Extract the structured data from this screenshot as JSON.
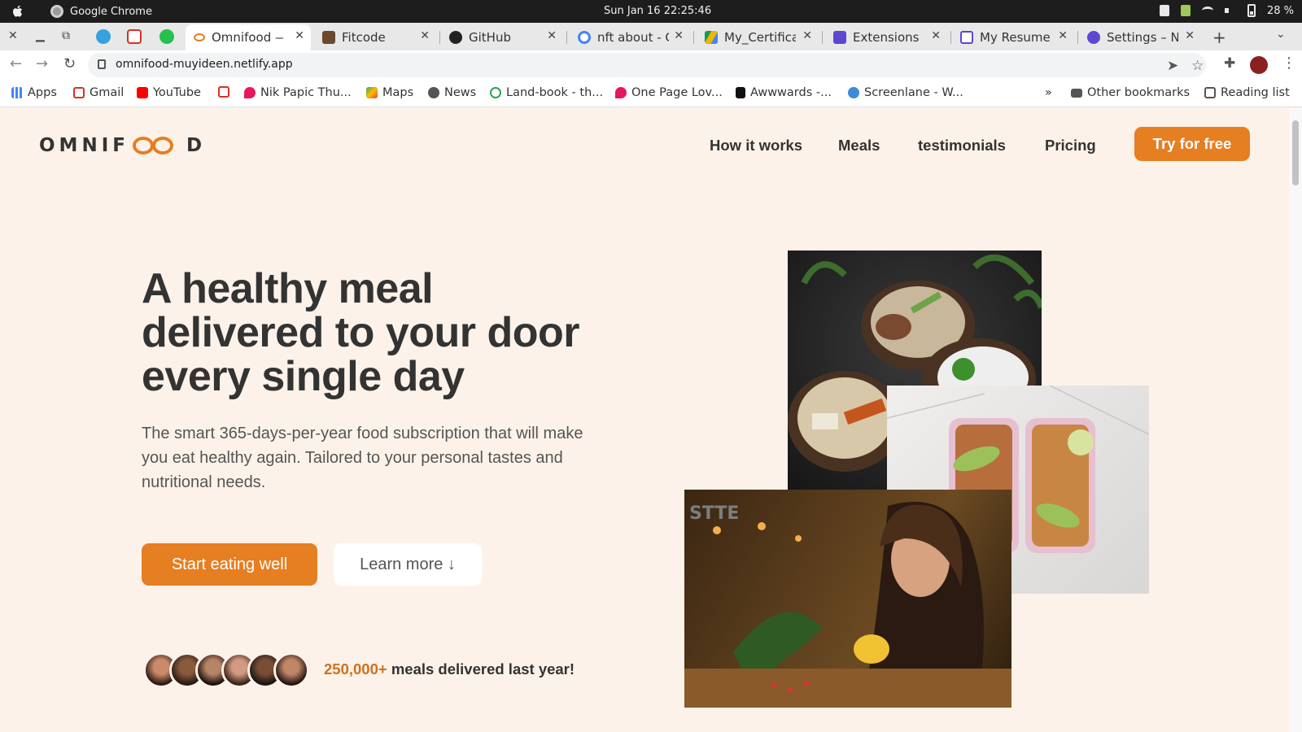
{
  "os": {
    "app_name": "Google Chrome",
    "clock": "Sun Jan 16  22:25:46",
    "battery": "28 %"
  },
  "tabs": [
    {
      "label": "Omnifood —",
      "active": true
    },
    {
      "label": "Fitcode"
    },
    {
      "label": "GitHub"
    },
    {
      "label": "nft about - Go"
    },
    {
      "label": "My_Certificat"
    },
    {
      "label": "Extensions"
    },
    {
      "label": "My Resume - G"
    },
    {
      "label": "Settings – No"
    }
  ],
  "address": {
    "url": "omnifood-muyideen.netlify.app"
  },
  "bookmarks": [
    {
      "label": "Apps"
    },
    {
      "label": "Gmail"
    },
    {
      "label": "YouTube"
    },
    {
      "label": "Nik Papic Thu..."
    },
    {
      "label": "Maps"
    },
    {
      "label": "News"
    },
    {
      "label": "Land-book - th..."
    },
    {
      "label": "One Page Lov..."
    },
    {
      "label": "Awwwards -..."
    },
    {
      "label": "Screenlane - W..."
    }
  ],
  "bookmarks_extra": {
    "overflow": "»",
    "other": "Other bookmarks",
    "reading": "Reading list"
  },
  "site": {
    "logo_left": "OMNIF",
    "logo_right": "D",
    "nav": [
      "How it works",
      "Meals",
      "testimonials",
      "Pricing"
    ],
    "cta": "Try for free",
    "hero_title": "A healthy meal delivered to your door every single day",
    "hero_desc": "The smart 365-days-per-year food subscription that will make you eat healthy again. Tailored to your personal tastes and nutritional needs.",
    "btn_primary": "Start eating well",
    "btn_secondary": "Learn more ↓",
    "delivered_count": "250,000+",
    "delivered_text": " meals delivered last year!"
  },
  "colors": {
    "accent": "#e67e22",
    "page_bg": "#fdf2e9",
    "text": "#333333"
  }
}
